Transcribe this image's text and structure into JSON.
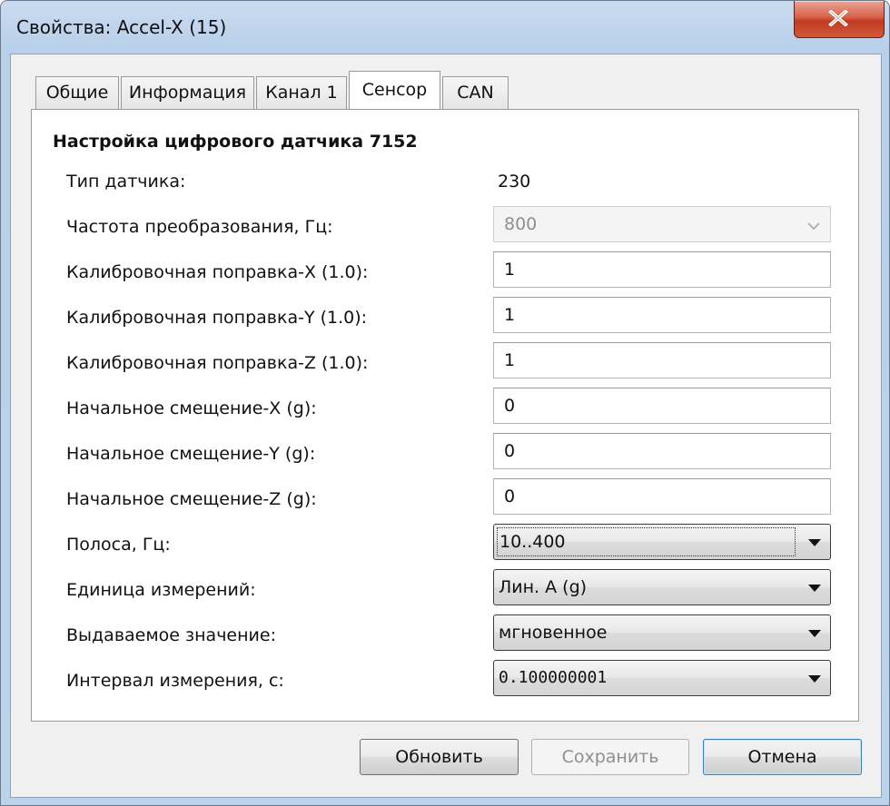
{
  "window": {
    "title": "Свойства: Accel-X (15)"
  },
  "tabs": [
    {
      "label": "Общие",
      "active": false
    },
    {
      "label": "Информация",
      "active": false
    },
    {
      "label": "Канал 1",
      "active": false
    },
    {
      "label": "Сенсор",
      "active": true
    },
    {
      "label": "CAN",
      "active": false
    }
  ],
  "panel": {
    "section_title": "Настройка цифрового датчика 7152",
    "sensor_type": {
      "label": "Тип датчика:",
      "value": "230"
    },
    "conversion_rate": {
      "label": "Частота преобразования, Гц:",
      "value": "800",
      "enabled": false
    },
    "calib_x": {
      "label": "Калибровочная поправка-X (1.0):",
      "value": "1"
    },
    "calib_y": {
      "label": "Калибровочная поправка-Y (1.0):",
      "value": "1"
    },
    "calib_z": {
      "label": "Калибровочная поправка-Z (1.0):",
      "value": "1"
    },
    "offset_x": {
      "label": "Начальное смещение-X (g):",
      "value": "0"
    },
    "offset_y": {
      "label": "Начальное смещение-Y (g):",
      "value": "0"
    },
    "offset_z": {
      "label": "Начальное смещение-Z (g):",
      "value": "0"
    },
    "bandwidth": {
      "label": "Полоса, Гц:",
      "value": "10..400"
    },
    "unit": {
      "label": "Единица измерений:",
      "value": "Лин. А (g)"
    },
    "output_value": {
      "label": "Выдаваемое значение:",
      "value": "мгновенное"
    },
    "interval": {
      "label": "Интервал измерения, с:",
      "value": "0.100000001"
    }
  },
  "buttons": {
    "refresh": "Обновить",
    "save": "Сохранить",
    "cancel": "Отмена"
  },
  "icons": {
    "close": "close-icon",
    "dropdown": "chevron-down-icon"
  },
  "colors": {
    "titlebar": "#bcd3ec",
    "close_button": "#c23a20",
    "dialog_background": "#f0f0f0",
    "panel_background": "#ffffff",
    "disabled_text": "#8f8f8f"
  }
}
